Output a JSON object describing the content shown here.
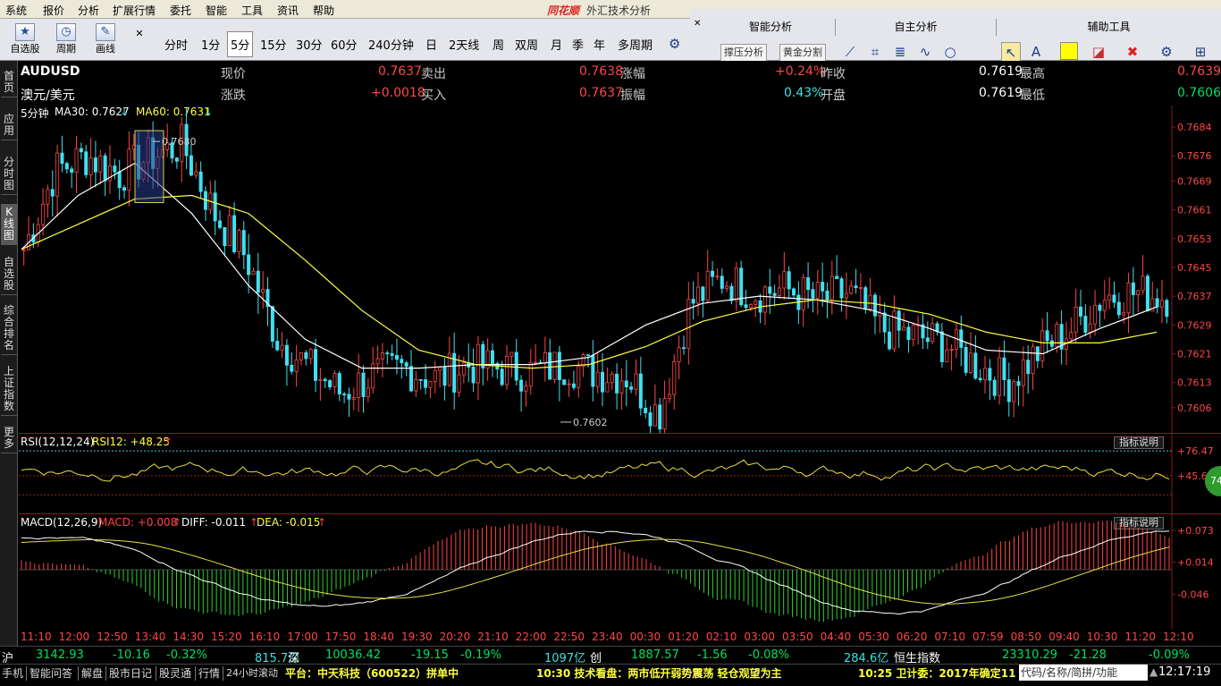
{
  "menu": [
    "系统",
    "报价",
    "分析",
    "扩展行情",
    "委托",
    "智能",
    "工具",
    "资讯",
    "帮助"
  ],
  "app": {
    "brand": "同花顺",
    "title": "外汇技术分析"
  },
  "toolbar": {
    "left_buttons": [
      {
        "label": "自选股",
        "icon": "star-icon"
      },
      {
        "label": "周期",
        "icon": "clock-icon"
      },
      {
        "label": "画线",
        "icon": "pen-icon"
      }
    ],
    "periods": [
      "分时",
      "1分",
      "5分",
      "15分",
      "30分",
      "60分",
      "240分钟",
      "日",
      "2天线",
      "周",
      "双周",
      "月",
      "季",
      "年",
      "多周期"
    ],
    "selected_period": "5分",
    "panels": [
      {
        "title": "智能分析",
        "buttons": [
          "撑压分析",
          "黄金分割"
        ]
      },
      {
        "title": "自主分析",
        "buttons": []
      },
      {
        "title": "辅助工具",
        "buttons": []
      }
    ]
  },
  "side_tabs": [
    "首页",
    "应用",
    "分时图",
    "K线图",
    "自选股",
    "综合排名",
    "上证指数",
    "更多"
  ],
  "active_side_tab": "K线图",
  "quote": {
    "symbol": "AUDUSD",
    "name": "澳元/美元",
    "cells": [
      {
        "label": "现价",
        "value": "0.7637",
        "color": "red"
      },
      {
        "label": "卖出",
        "value": "0.7638",
        "color": "red"
      },
      {
        "label": "涨幅",
        "value": "+0.24%",
        "color": "red"
      },
      {
        "label": "昨收",
        "value": "0.7619",
        "color": "wht"
      },
      {
        "label": "最高",
        "value": "0.7639",
        "color": "red"
      },
      {
        "label": "涨跌",
        "value": "+0.0018",
        "color": "red"
      },
      {
        "label": "买入",
        "value": "0.7637",
        "color": "red"
      },
      {
        "label": "振幅",
        "value": "0.43%",
        "color": "cyan"
      },
      {
        "label": "开盘",
        "value": "0.7619",
        "color": "wht"
      },
      {
        "label": "最低",
        "value": "0.7606",
        "color": "grn"
      }
    ]
  },
  "kline": {
    "period_label": "5分钟",
    "ma30_label": "MA30: 0.7627",
    "ma60_label": "MA60: 0.7631",
    "high_label": "0.7680",
    "low_label": "0.7602",
    "yticks": [
      "0.7684",
      "0.7676",
      "0.7669",
      "0.7661",
      "0.7653",
      "0.7645",
      "0.7637",
      "0.7629",
      "0.7621",
      "0.7613",
      "0.7606"
    ]
  },
  "rsi": {
    "title": "RSI(12,12,24)",
    "value_label": "RSI12: +48.25",
    "button": "指标说明",
    "yticks": [
      "+76.47",
      "+45.63"
    ],
    "badge": "74"
  },
  "macd": {
    "title": "MACD(12,26,9)",
    "macd_label": "MACD: +0.008",
    "diff_label": "DIFF: -0.011",
    "dea_label": "DEA: -0.015",
    "button": "指标说明",
    "yticks": [
      "+0.073",
      "+0.014",
      "-0.046"
    ]
  },
  "time_axis": [
    "11:10",
    "12:00",
    "12:50",
    "13:40",
    "14:30",
    "15:20",
    "16:10",
    "17:00",
    "17:50",
    "18:40",
    "19:30",
    "20:20",
    "21:10",
    "22:00",
    "22:50",
    "23:40",
    "00:30",
    "01:20",
    "02:10",
    "03:00",
    "03:50",
    "04:40",
    "05:30",
    "06:20",
    "07:10",
    "07:59",
    "08:50",
    "09:40",
    "10:30",
    "11:20",
    "12:10"
  ],
  "chart_data": {
    "type": "candlestick",
    "symbol": "AUDUSD",
    "interval": "5分钟",
    "ylim": [
      0.76,
      0.7686
    ],
    "anchor_points": [
      0.765,
      0.7672,
      0.7676,
      0.7671,
      0.7676,
      0.7679,
      0.766,
      0.7648,
      0.7625,
      0.7617,
      0.761,
      0.7615,
      0.7617,
      0.7614,
      0.7618,
      0.7617,
      0.7616,
      0.7618,
      0.7616,
      0.7615,
      0.7604,
      0.7635,
      0.7642,
      0.7638,
      0.7639,
      0.7636,
      0.7638,
      0.7628,
      0.7626,
      0.7624,
      0.7618,
      0.7613,
      0.7622,
      0.7628,
      0.7637,
      0.7638,
      0.7637
    ],
    "ma30_points": [
      0.765,
      0.7665,
      0.7674,
      0.766,
      0.764,
      0.7625,
      0.7617,
      0.7617,
      0.7618,
      0.7618,
      0.762,
      0.7629,
      0.7635,
      0.7637,
      0.7636,
      0.7633,
      0.7628,
      0.7622,
      0.7621,
      0.7628,
      0.7634
    ],
    "ma60_points": [
      0.765,
      0.7657,
      0.7664,
      0.7665,
      0.766,
      0.7647,
      0.7633,
      0.7622,
      0.7618,
      0.7617,
      0.7618,
      0.7623,
      0.763,
      0.7634,
      0.7636,
      0.7635,
      0.7632,
      0.7627,
      0.7624,
      0.7624,
      0.7627
    ],
    "high": 0.768,
    "low": 0.7602,
    "rsi_levels": [
      76.47,
      45.63
    ],
    "macd_levels": [
      0.073,
      0.014,
      -0.046
    ]
  },
  "indexbar": [
    {
      "label": "沪",
      "color": "wht"
    },
    {
      "label": "3142.93",
      "color": "grn"
    },
    {
      "label": "-10.16",
      "color": "grn"
    },
    {
      "label": "-0.32%",
      "color": "grn"
    },
    {
      "label": "815.7亿",
      "color": "cyan"
    },
    {
      "label": "深",
      "color": "wht"
    },
    {
      "label": "10036.42",
      "color": "grn"
    },
    {
      "label": "-19.15",
      "color": "grn"
    },
    {
      "label": "-0.19%",
      "color": "grn"
    },
    {
      "label": "1097亿",
      "color": "cyan"
    },
    {
      "label": "创",
      "color": "wht"
    },
    {
      "label": "1887.57",
      "color": "grn"
    },
    {
      "label": "-1.56",
      "color": "grn"
    },
    {
      "label": "-0.08%",
      "color": "grn"
    },
    {
      "label": "284.6亿",
      "color": "cyan"
    },
    {
      "label": "恒生指数",
      "color": "wht"
    },
    {
      "label": "23310.29",
      "color": "grn"
    },
    {
      "label": "-21.28",
      "color": "grn"
    },
    {
      "label": "-0.09%",
      "color": "grn"
    }
  ],
  "statusbar": {
    "tabs": [
      "手机",
      "智能问答",
      "解盘",
      "股市日记",
      "股灵通",
      "行情",
      "24小时滚动"
    ],
    "news": [
      "平台：中天科技（600522）拼单中",
      "10:30 技术看盘：两市低开弱势震荡 轻仓观望为主",
      "10:25 卫计委：2017年确定11"
    ],
    "search_placeholder": "代码/名称/简拼/功能",
    "clock": "12:17:19"
  }
}
